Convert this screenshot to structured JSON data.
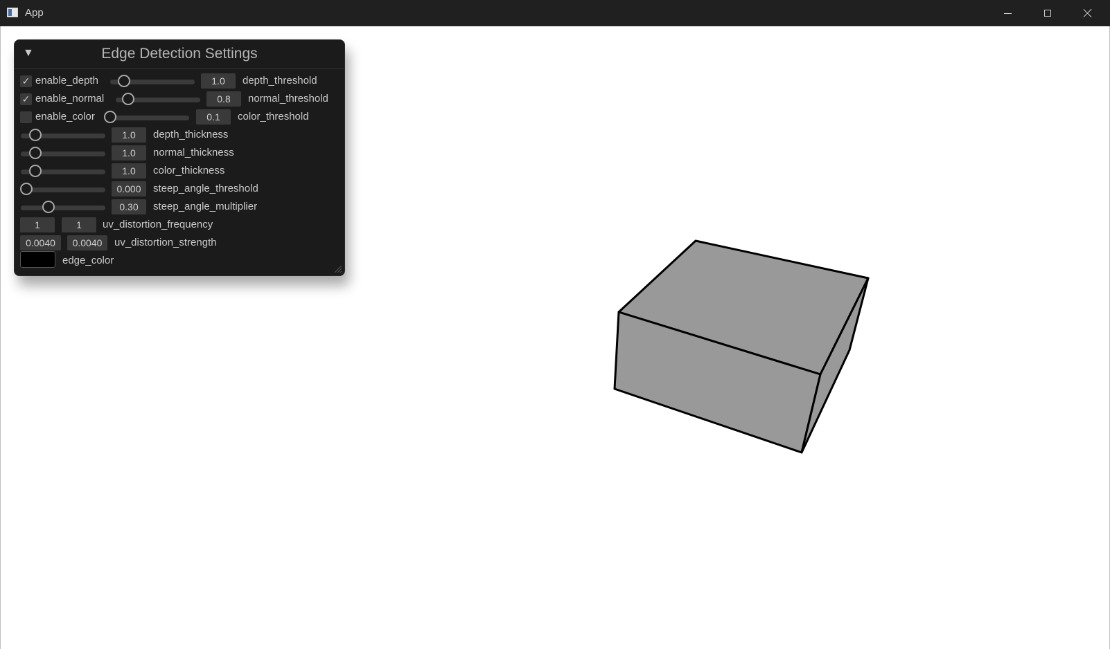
{
  "window": {
    "title": "App"
  },
  "panel": {
    "title": "Edge Detection Settings",
    "rows": [
      {
        "label": "enable_depth",
        "checked": true,
        "value": "1.0",
        "param": "depth_threshold",
        "level": 0.15
      },
      {
        "label": "enable_normal",
        "checked": true,
        "value": "0.8",
        "param": "normal_threshold",
        "level": 0.12
      },
      {
        "label": "enable_color",
        "checked": false,
        "value": "0.1",
        "param": "color_threshold",
        "level": 0.0
      },
      {
        "value": "1.0",
        "param": "depth_thickness",
        "level": 0.1
      },
      {
        "value": "1.0",
        "param": "normal_thickness",
        "level": 0.1
      },
      {
        "value": "1.0",
        "param": "color_thickness",
        "level": 0.1
      },
      {
        "value": "0.000",
        "param": "steep_angle_threshold",
        "level": 0.0
      },
      {
        "value": "0.30",
        "param": "steep_angle_multiplier",
        "level": 0.3
      },
      {
        "values": [
          "1",
          "1"
        ],
        "param": "uv_distortion_frequency"
      },
      {
        "values": [
          "0.0040",
          "0.0040"
        ],
        "param": "uv_distortion_strength"
      },
      {
        "param": "edge_color",
        "color": "#000000"
      }
    ]
  },
  "scene": {
    "object": "box",
    "face_color": "#999999",
    "edge_color": "#000000",
    "background": "#ffffff"
  }
}
